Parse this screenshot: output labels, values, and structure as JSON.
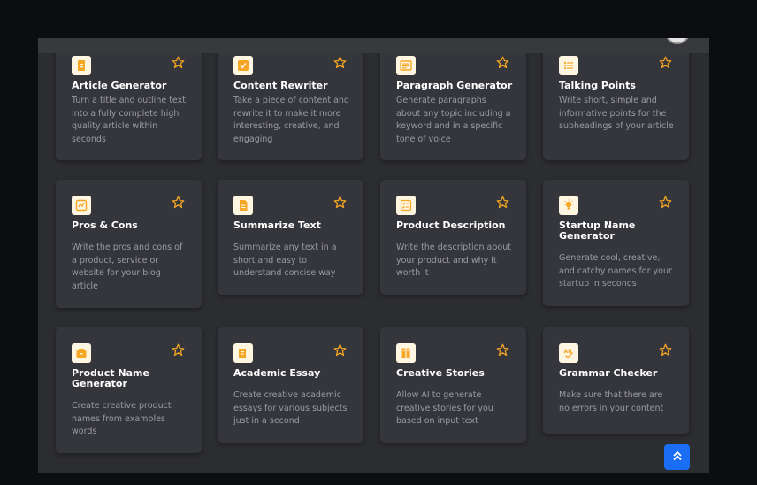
{
  "tools": [
    {
      "icon": "article-icon",
      "title": "Article Generator",
      "description": "Turn a title and outline text into a fully complete high quality article within seconds"
    },
    {
      "icon": "rewrite-icon",
      "title": "Content Rewriter",
      "description": "Take a piece of content and rewrite it to make it more interesting, creative, and engaging"
    },
    {
      "icon": "paragraph-icon",
      "title": "Paragraph Generator",
      "description": "Generate paragraphs about any topic including a keyword and in a specific tone of voice"
    },
    {
      "icon": "list-icon",
      "title": "Talking Points",
      "description": "Write short, simple and informative points for the subheadings of your article"
    },
    {
      "icon": "pros-cons-icon",
      "title": "Pros & Cons",
      "description": "Write the pros and cons of a product, service or website for your blog article"
    },
    {
      "icon": "document-icon",
      "title": "Summarize Text",
      "description": "Summarize any text in a short and easy to understand concise way"
    },
    {
      "icon": "checklist-icon",
      "title": "Product Description",
      "description": "Write the description about your product and why it worth it"
    },
    {
      "icon": "lightbulb-icon",
      "title": "Startup Name Generator",
      "description": "Generate cool, creative, and catchy names for your startup in seconds"
    },
    {
      "icon": "product-icon",
      "title": "Product Name Generator",
      "description": "Create creative product names from examples words"
    },
    {
      "icon": "scroll-icon",
      "title": "Academic Essay",
      "description": "Create creative academic essays for various subjects just in a second"
    },
    {
      "icon": "book-icon",
      "title": "Creative Stories",
      "description": "Allow AI to generate creative stories for you based on input text"
    },
    {
      "icon": "grammar-icon",
      "title": "Grammar Checker",
      "description": "Make sure that there are no errors in your content"
    }
  ],
  "colors": {
    "accent": "#f5a623",
    "icon_bg": "#fff6e2",
    "card_bg": "#35363b",
    "scroll_button": "#1a6ef5"
  }
}
